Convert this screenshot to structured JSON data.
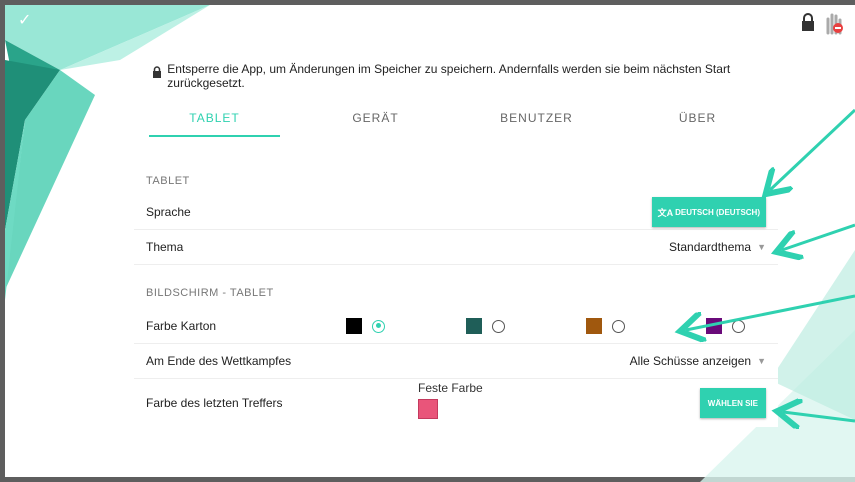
{
  "notice": "Entsperre die App, um Änderungen im Speicher zu speichern. Andernfalls werden sie beim nächsten Start zurückgesetzt.",
  "tabs": [
    {
      "label": "TABLET",
      "active": true
    },
    {
      "label": "GERÄT",
      "active": false
    },
    {
      "label": "BENUTZER",
      "active": false
    },
    {
      "label": "ÜBER",
      "active": false
    }
  ],
  "section_tablet": "TABLET",
  "language": {
    "label": "Sprache",
    "button": "DEUTSCH (DEUTSCH)",
    "icon": "translate-icon"
  },
  "theme": {
    "label": "Thema",
    "value": "Standardthema"
  },
  "section_screen": "BILDSCHIRM - TABLET",
  "card_color": {
    "label": "Farbe Karton",
    "options": [
      {
        "color": "#000000",
        "selected": true
      },
      {
        "color": "#1f5e58",
        "selected": false
      },
      {
        "color": "#a0580e",
        "selected": false
      },
      {
        "color": "#6a0a7a",
        "selected": false
      }
    ]
  },
  "end_of_competition": {
    "label": "Am Ende des Wettkampfes",
    "value": "Alle Schüsse anzeigen"
  },
  "last_hit_color": {
    "label": "Farbe des letzten Treffers",
    "fixed_label": "Feste Farbe",
    "fixed_color": "#e9557a",
    "button": "WÄHLEN SIE"
  },
  "colors": {
    "accent": "#2fd1b0",
    "arrow": "#2fd1b0"
  }
}
